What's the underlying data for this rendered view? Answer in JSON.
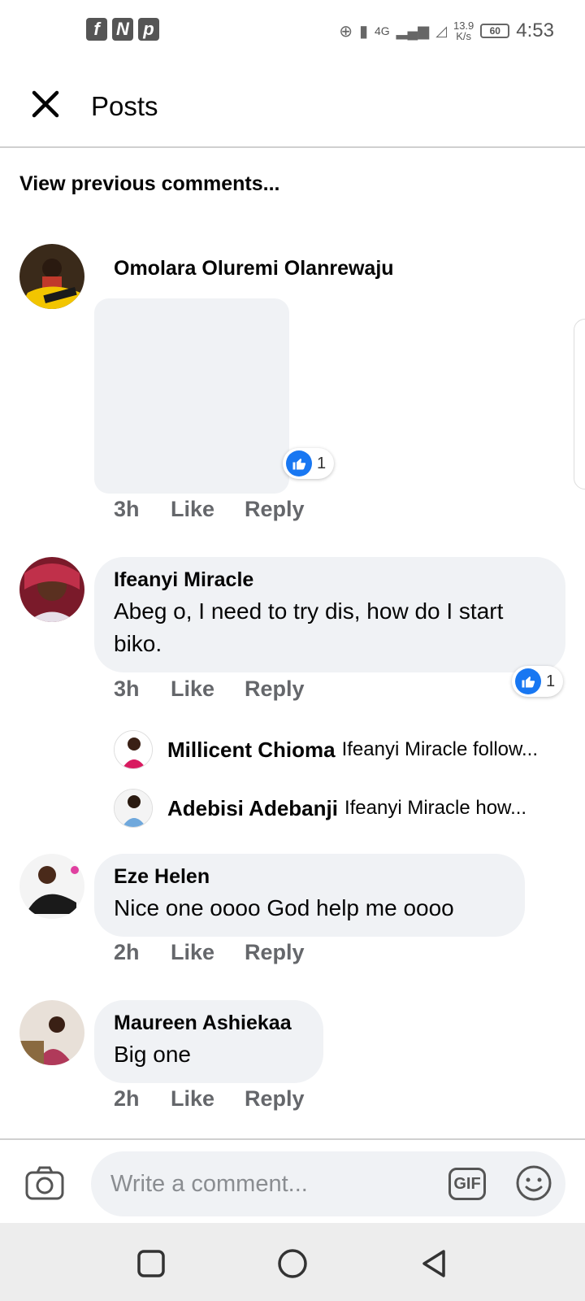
{
  "status_bar": {
    "apps": [
      "f",
      "N",
      "p"
    ],
    "network": "4G",
    "speed_value": "13.9",
    "speed_unit": "K/s",
    "battery": "60",
    "time": "4:53"
  },
  "header": {
    "title": "Posts"
  },
  "view_previous": "View previous comments...",
  "comments": [
    {
      "author": "Omolara Oluremi Olanrewaju",
      "time": "3h",
      "like": "Like",
      "reply": "Reply",
      "reaction_count": "1"
    },
    {
      "author": "Ifeanyi Miracle",
      "text": "Abeg o, I need to try dis, how do I start biko.",
      "time": "3h",
      "like": "Like",
      "reply": "Reply",
      "reaction_count": "1",
      "replies": [
        {
          "author": "Millicent Chioma",
          "preview": "Ifeanyi Miracle follow..."
        },
        {
          "author": "Adebisi Adebanji",
          "preview": "Ifeanyi Miracle how..."
        }
      ]
    },
    {
      "author": "Eze Helen",
      "text": "Nice one oooo God help me oooo",
      "time": "2h",
      "like": "Like",
      "reply": "Reply"
    },
    {
      "author": "Maureen Ashiekaa",
      "text": "Big one",
      "time": "2h",
      "like": "Like",
      "reply": "Reply"
    }
  ],
  "composer": {
    "placeholder": "Write a comment...",
    "gif_label": "GIF"
  },
  "icons": {
    "close": "close-icon",
    "camera": "camera-icon",
    "gif": "gif-icon",
    "emoji": "emoji-icon",
    "like": "thumbs-up-icon",
    "nav_recent": "square-icon",
    "nav_home": "circle-icon",
    "nav_back": "triangle-back-icon"
  },
  "colors": {
    "like_blue": "#1877f2",
    "bubble_bg": "#f0f2f5",
    "meta_gray": "#65676b"
  }
}
